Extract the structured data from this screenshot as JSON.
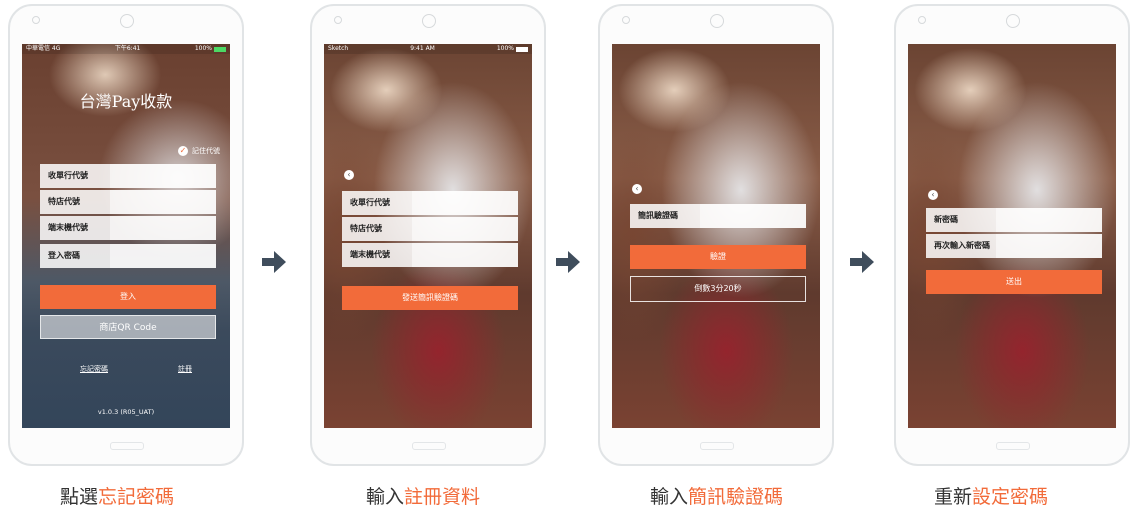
{
  "colors": {
    "accent": "#f26b3a",
    "arrow": "#3f4d5c"
  },
  "phone1": {
    "status": {
      "carrier": "中華電信 4G",
      "time": "下午6:41",
      "battery": "100%"
    },
    "title": "台灣Pay收款",
    "remember": "記住代號",
    "fields": [
      "收單行代號",
      "特店代號",
      "端末機代號",
      "登入密碼"
    ],
    "login": "登入",
    "qr": "商店QR Code",
    "forgot": "忘記密碼",
    "register": "註冊",
    "version": "v1.0.3 (R05_UAT)"
  },
  "phone2": {
    "status": {
      "carrier": "Sketch",
      "time": "9:41 AM",
      "battery": "100%"
    },
    "fields": [
      "收單行代號",
      "特店代號",
      "端末機代號"
    ],
    "send": "發送簡訊驗證碼"
  },
  "phone3": {
    "field": "簡訊驗證碼",
    "verify": "驗證",
    "countdown": "倒數3分20秒"
  },
  "phone4": {
    "fields": [
      "新密碼",
      "再次輸入新密碼"
    ],
    "submit": "送出"
  },
  "captions": [
    {
      "pre": "點選",
      "hl": "忘記密碼"
    },
    {
      "pre": "輸入",
      "hl": "註冊資料"
    },
    {
      "pre": "輸入",
      "hl": "簡訊驗證碼"
    },
    {
      "pre": "重新",
      "hl": "設定密碼"
    }
  ]
}
